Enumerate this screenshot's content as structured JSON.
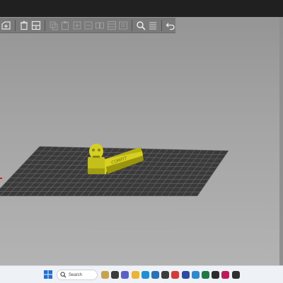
{
  "toolbar": {
    "buttons": [
      {
        "name": "add-icon",
        "enabled": true
      },
      {
        "name": "delete-icon",
        "enabled": true
      },
      {
        "name": "arrange-icon",
        "enabled": true
      },
      {
        "name": "copy-icon",
        "enabled": false
      },
      {
        "name": "paste-icon",
        "enabled": false
      },
      {
        "name": "add-instance-icon",
        "enabled": false
      },
      {
        "name": "remove-instance-icon",
        "enabled": false
      },
      {
        "name": "split-objects-icon",
        "enabled": false
      },
      {
        "name": "split-parts-icon",
        "enabled": false
      },
      {
        "name": "layer-editing-icon",
        "enabled": false
      },
      {
        "name": "search-icon",
        "enabled": true
      },
      {
        "name": "list-icon",
        "enabled": true
      },
      {
        "name": "undo-icon",
        "enabled": true
      }
    ]
  },
  "scene": {
    "bed_color": "#3a3a3a",
    "grid_color": "#6e6e6e",
    "model_color": "#c9c41a",
    "model_shadow": "#8a8510",
    "model_text": "COMFIT"
  },
  "taskbar": {
    "search_placeholder": "Search",
    "apps": [
      {
        "name": "weather-icon",
        "color": "#c9a24a"
      },
      {
        "name": "task-view-icon",
        "color": "#3b3b3b"
      },
      {
        "name": "chat-icon",
        "color": "#5b5fc7"
      },
      {
        "name": "file-explorer-icon",
        "color": "#e8b53a"
      },
      {
        "name": "edge-icon",
        "color": "#1f8fd6"
      },
      {
        "name": "store-icon",
        "color": "#2d6fb5"
      },
      {
        "name": "settings-icon",
        "color": "#3d3d3d"
      },
      {
        "name": "opera-icon",
        "color": "#d43b3b"
      },
      {
        "name": "prusaslicer-icon",
        "color": "#2d4aa8"
      },
      {
        "name": "photos-icon",
        "color": "#2a8ad4"
      },
      {
        "name": "excel-icon",
        "color": "#1e7a45"
      },
      {
        "name": "app-icon",
        "color": "#2c2c2c"
      },
      {
        "name": "raspberry-icon",
        "color": "#c2185b"
      },
      {
        "name": "vlc-icon",
        "color": "#2f2f2f"
      }
    ]
  }
}
